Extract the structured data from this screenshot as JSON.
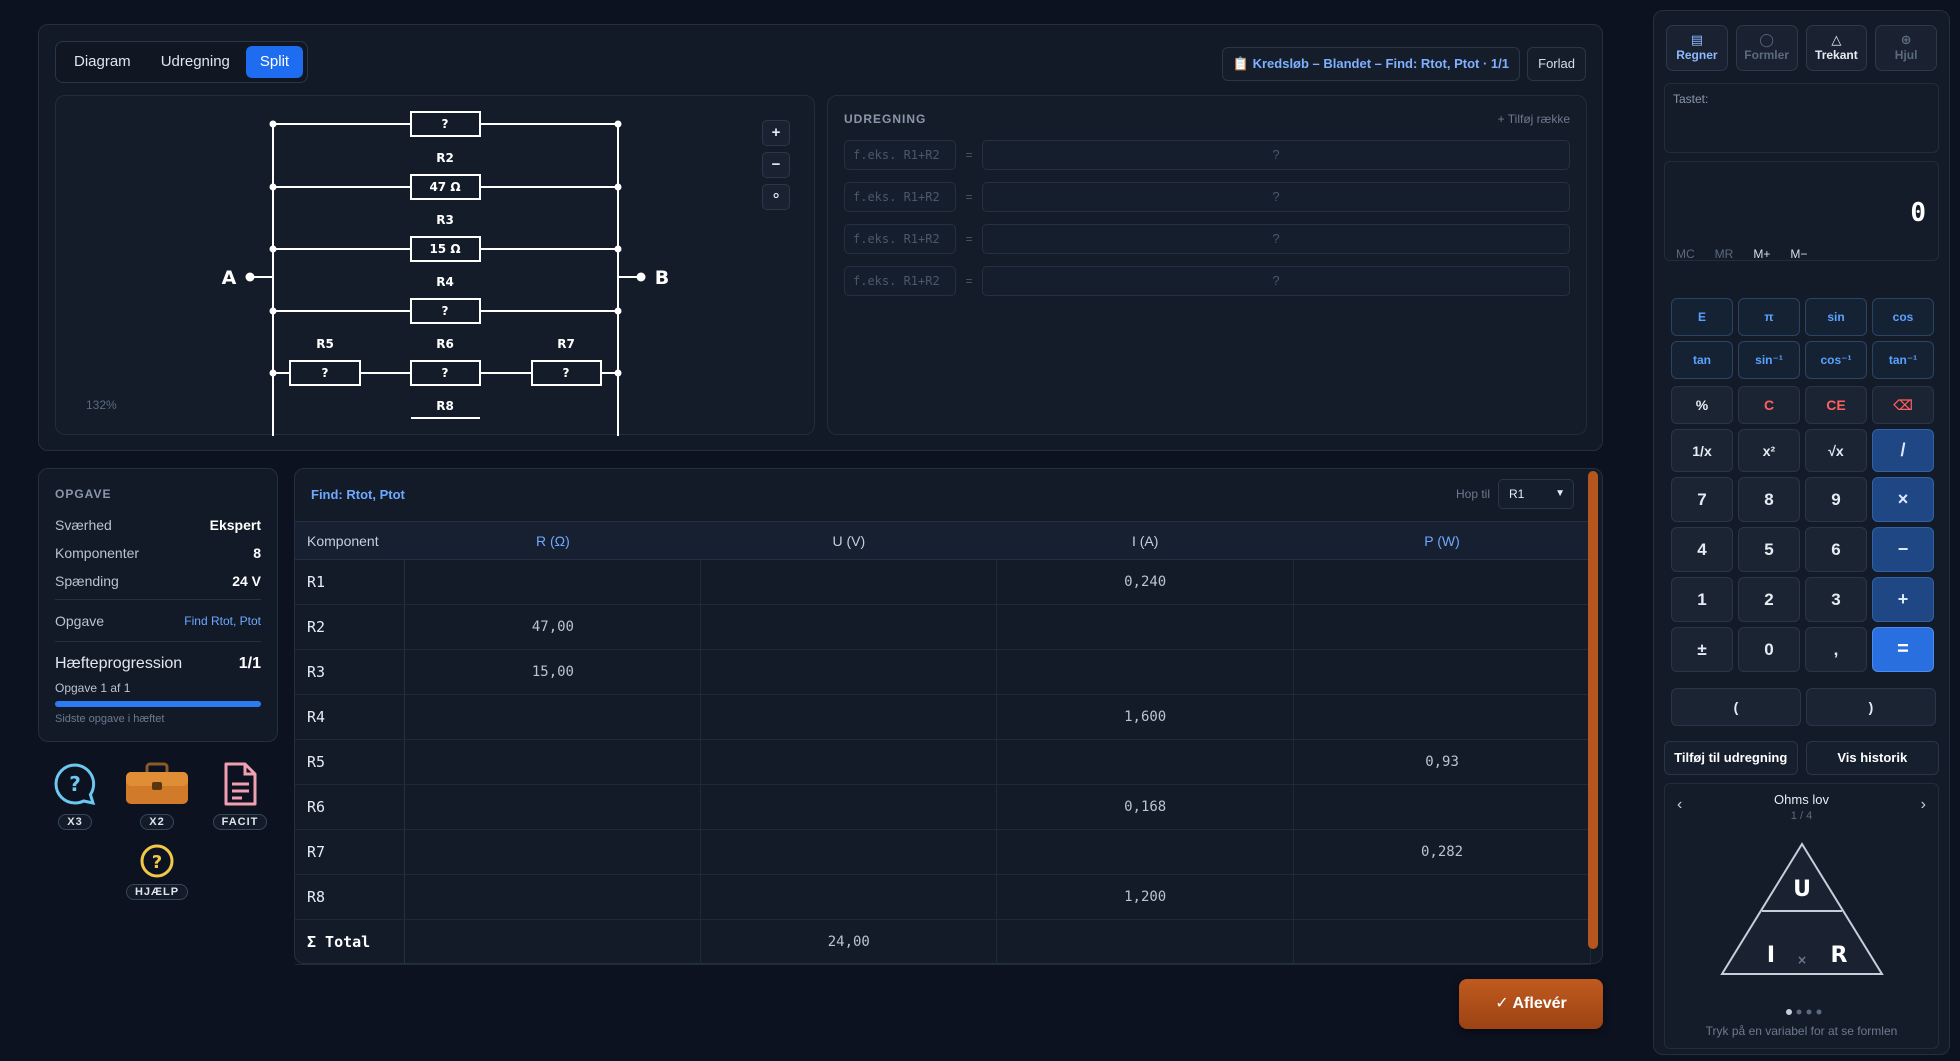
{
  "view_tabs": [
    "Diagram",
    "Udregning",
    "Split"
  ],
  "active_view": "Split",
  "breadcrumb": "📋 Kredsløb – Blandet – Find: Rtot, Ptot · 1/1",
  "leave_label": "Forlad",
  "diagram": {
    "zoom_label": "132%",
    "zoom_in": "+",
    "zoom_out": "−",
    "zoom_reset": "⚬",
    "node_a": "A",
    "node_b": "B",
    "resistors": {
      "top": {
        "label": "",
        "value": "?"
      },
      "r2": {
        "label": "R2",
        "value": "47 Ω"
      },
      "r3": {
        "label": "R3",
        "value": "15 Ω"
      },
      "r4": {
        "label": "R4",
        "value": "?"
      },
      "r5": {
        "label": "R5",
        "value": "?"
      },
      "r6": {
        "label": "R6",
        "value": "?"
      },
      "r7": {
        "label": "R7",
        "value": "?"
      },
      "r8": {
        "label": "R8",
        "value": ""
      }
    }
  },
  "udregning": {
    "title": "UDREGNING",
    "add_row": "+ Tilføj række",
    "rows": [
      {
        "placeholder": "f.eks. R1+R2",
        "eq": "=",
        "result": "?"
      },
      {
        "placeholder": "f.eks. R1+R2",
        "eq": "=",
        "result": "?"
      },
      {
        "placeholder": "f.eks. R1+R2",
        "eq": "=",
        "result": "?"
      },
      {
        "placeholder": "f.eks. R1+R2",
        "eq": "=",
        "result": "?"
      }
    ]
  },
  "task": {
    "header": "OPGAVE",
    "rows": [
      {
        "key": "Sværhed",
        "value": "Ekspert"
      },
      {
        "key": "Komponenter",
        "value": "8"
      },
      {
        "key": "Spænding",
        "value": "24 V"
      }
    ],
    "opgave_key": "Opgave",
    "opgave_value": "Find Rtot, Ptot",
    "progress_title": "Hæfteprogression",
    "progress_value": "1/1",
    "progress_sub": "Opgave 1 af 1",
    "progress_fraction": 1.0,
    "progress_last": "Sidste opgave i hæftet"
  },
  "tools": [
    {
      "name": "help-chat",
      "badge": "X3"
    },
    {
      "name": "toolbox",
      "badge": "X2"
    },
    {
      "name": "facit",
      "badge": "FACIT"
    },
    {
      "name": "hjaelp",
      "badge": "HJÆLP"
    }
  ],
  "table": {
    "find_label": "Find: Rtot, Ptot",
    "hop_label": "Hop til",
    "hop_value": "R1",
    "columns": [
      "Komponent",
      "R (Ω)",
      "U (V)",
      "I (A)",
      "P (W)"
    ],
    "rows": [
      [
        "R1",
        "",
        "",
        "0,240",
        ""
      ],
      [
        "R2",
        "47,00",
        "",
        "",
        ""
      ],
      [
        "R3",
        "15,00",
        "",
        "",
        ""
      ],
      [
        "R4",
        "",
        "",
        "1,600",
        ""
      ],
      [
        "R5",
        "",
        "",
        "",
        "0,93"
      ],
      [
        "R6",
        "",
        "",
        "0,168",
        ""
      ],
      [
        "R7",
        "",
        "",
        "",
        "0,282"
      ],
      [
        "R8",
        "",
        "",
        "1,200",
        ""
      ],
      [
        "Σ Total",
        "",
        "24,00",
        "",
        ""
      ]
    ]
  },
  "submit_label": "✓  Aflevér",
  "calculator": {
    "tabs": [
      {
        "label": "Regner",
        "icon": "▤",
        "active": true
      },
      {
        "label": "Formler",
        "icon": "◯",
        "active": false
      },
      {
        "label": "Trekant",
        "icon": "△",
        "active": true
      },
      {
        "label": "Hjul",
        "icon": "⊕",
        "active": false
      }
    ],
    "tastet_label": "Tastet:",
    "display": "0",
    "memory": [
      "MC",
      "MR",
      "M+",
      "M−"
    ],
    "fn_keys": [
      "E",
      "π",
      "sin",
      "cos",
      "tan",
      "sin⁻¹",
      "cos⁻¹",
      "tan⁻¹"
    ],
    "keys": [
      "%",
      "C",
      "CE",
      "⌫",
      "1/x",
      "x²",
      "√x",
      "/",
      "7",
      "8",
      "9",
      "×",
      "4",
      "5",
      "6",
      "−",
      "1",
      "2",
      "3",
      "+",
      "±",
      "0",
      ",",
      "="
    ],
    "parens": [
      "(",
      ")"
    ],
    "add_to_calc": "Tilføj til udregning",
    "show_history": "Vis historik",
    "ohms": {
      "title": "Ohms lov",
      "page": "1 / 4",
      "prev": "‹",
      "next": "›",
      "u": "U",
      "i": "I",
      "r": "R",
      "times": "×",
      "hint": "Tryk på en variabel for at se formlen"
    }
  }
}
